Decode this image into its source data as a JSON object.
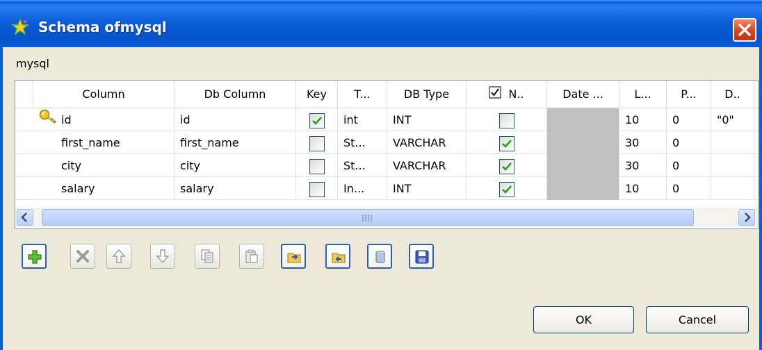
{
  "window": {
    "title": "Schema ofmysql",
    "subtitle": "mysql",
    "close_icon": "close-icon"
  },
  "table": {
    "headers": {
      "column": "Column",
      "db_column": "Db Column",
      "key": "Key",
      "type": "T...",
      "db_type": "DB Type",
      "nullable": "N..",
      "date_pattern": "Date ...",
      "length": "L...",
      "precision": "P...",
      "default": "D.."
    },
    "rows": [
      {
        "column": "id",
        "db_column": "id",
        "key": true,
        "type": "int",
        "db_type": "INT",
        "nullable": false,
        "length": "10",
        "precision": "0",
        "default": "\"0\"",
        "key_icon": "key-icon"
      },
      {
        "column": "first_name",
        "db_column": "first_name",
        "key": false,
        "type": "St...",
        "db_type": "VARCHAR",
        "nullable": true,
        "length": "30",
        "precision": "0",
        "default": ""
      },
      {
        "column": "city",
        "db_column": "city",
        "key": false,
        "type": "St...",
        "db_type": "VARCHAR",
        "nullable": true,
        "length": "30",
        "precision": "0",
        "default": ""
      },
      {
        "column": "salary",
        "db_column": "salary",
        "key": false,
        "type": "In...",
        "db_type": "INT",
        "nullable": true,
        "length": "10",
        "precision": "0",
        "default": ""
      }
    ]
  },
  "toolbar": {
    "buttons": [
      "add-icon",
      "remove-icon",
      "move-up-icon",
      "move-down-icon",
      "copy-icon",
      "paste-icon",
      "import-icon",
      "export-icon",
      "database-icon",
      "save-icon"
    ]
  },
  "footer": {
    "ok_label": "OK",
    "cancel_label": "Cancel"
  },
  "colors": {
    "titlebar": "#0a5ed8",
    "close": "#d6441f",
    "check": "#21a121",
    "date_cell": "#c0c0c0"
  }
}
